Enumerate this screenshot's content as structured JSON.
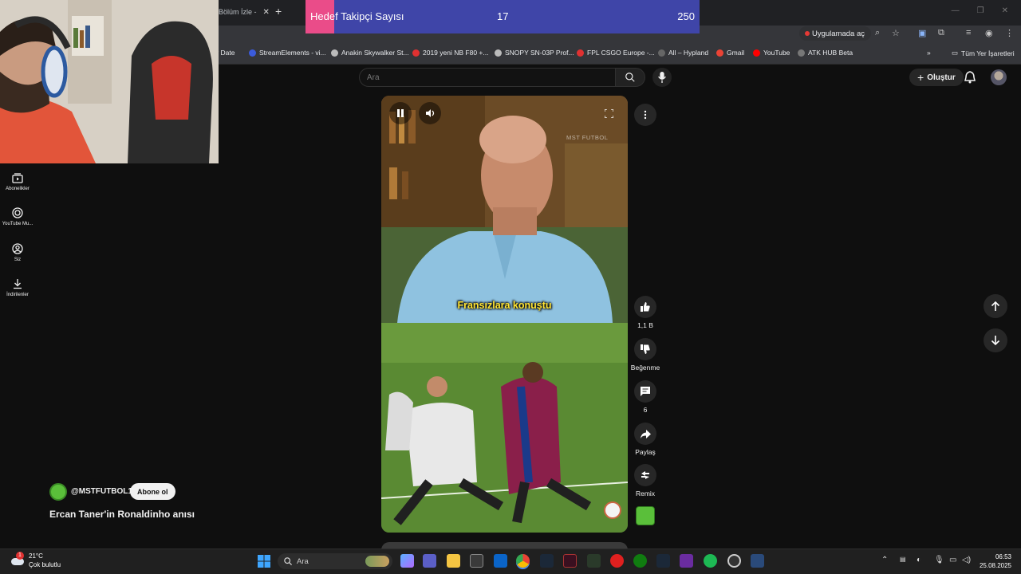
{
  "browser": {
    "tab_title": "Bölüm İzle -",
    "open_in_app": "Uygulamada aç",
    "bookmarks": [
      {
        "label": "w Date",
        "color": "#888888"
      },
      {
        "label": "StreamElements - vi...",
        "color": "#3b5bdb"
      },
      {
        "label": "Anakin Skywalker St...",
        "color": "#bbbbbb"
      },
      {
        "label": "2019 yeni NB F80 +...",
        "color": "#e03131"
      },
      {
        "label": "SNOPY SN-03P Prof...",
        "color": "#bbbbbb"
      },
      {
        "label": "FPL CSGO Europe -...",
        "color": "#e03131"
      },
      {
        "label": "All – Hypland",
        "color": "#666666"
      },
      {
        "label": "Gmail",
        "color": "#ea4335"
      },
      {
        "label": "YouTube",
        "color": "#ff0000"
      },
      {
        "label": "ATK HUB Beta",
        "color": "#777777"
      }
    ],
    "all_bookmarks": "Tüm Yer İşaretleri"
  },
  "overlay": {
    "goal_label": "Hedef Takipçi Sayısı",
    "goal_current": "17",
    "goal_target": "250"
  },
  "youtube": {
    "search_placeholder": "Ara",
    "create_label": "Oluştur",
    "nav": [
      {
        "label": "Abonelikler",
        "icon": "subscriptions-icon"
      },
      {
        "label": "YouTube Mu...",
        "icon": "youtube-music-icon"
      },
      {
        "label": "Siz",
        "icon": "you-icon"
      },
      {
        "label": "İndirilenler",
        "icon": "download-icon"
      }
    ],
    "video": {
      "caption": "Fransızlara konuştu",
      "watermark": "MST FUTBOL"
    },
    "actions": {
      "like_count": "1,1 B",
      "dislike_label": "Beğenme",
      "comments_count": "6",
      "share_label": "Paylaş",
      "remix_label": "Remix"
    },
    "channel": {
      "handle": "@MSTFUTBOL1",
      "subscribe_label": "Abone ol"
    },
    "short_title": "Ercan Taner'in Ronaldinho anısı"
  },
  "taskbar": {
    "weather_temp": "21°C",
    "weather_desc": "Çok bulutlu",
    "weather_badge": "1",
    "search_label": "Ara",
    "time": "06:53",
    "date": "25.08.2025"
  }
}
